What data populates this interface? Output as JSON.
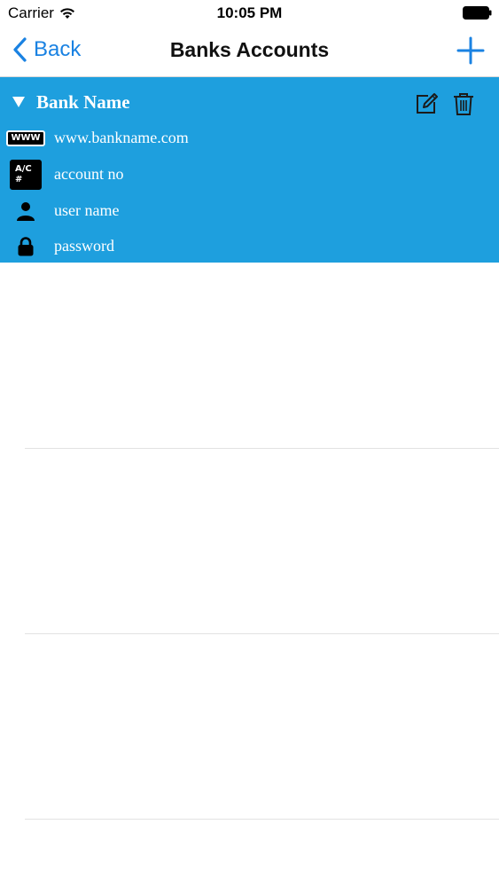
{
  "status_bar": {
    "carrier": "Carrier",
    "time": "10:05 PM"
  },
  "nav": {
    "back_label": "Back",
    "title": "Banks Accounts"
  },
  "account": {
    "bank_name": "Bank Name",
    "website": "www.bankname.com",
    "account_no": "account no",
    "user_name": "user name",
    "password": "password",
    "icons": {
      "www": "WWW",
      "account": "A/C #"
    }
  },
  "colors": {
    "accent": "#1a82e2",
    "card_bg": "#1e9fde"
  }
}
